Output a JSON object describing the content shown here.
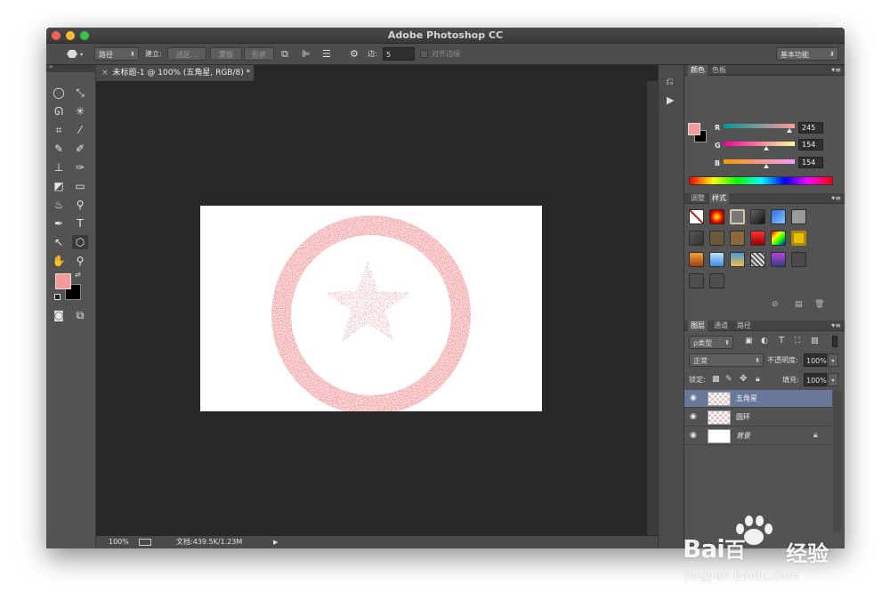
{
  "window": {
    "title": "Adobe Photoshop CC"
  },
  "options_bar": {
    "mode_dropdown": "路径",
    "make_label": "建立:",
    "selection_button": "选区...",
    "mask_button": "蒙版",
    "shape_button": "形状",
    "sides_label": "边:",
    "sides_value": "5",
    "align_edges_label": "对齐边缘",
    "workspace_dropdown": "基本功能"
  },
  "document": {
    "tab_title": "未标题-1 @ 100% (五角星, RGB/8) *",
    "zoom": "100%",
    "doc_size": "文档:439.5K/1.23M"
  },
  "colors": {
    "foreground": "#f59a9a",
    "background": "#000000",
    "accent_selection": "#68789a"
  },
  "color_panel": {
    "tabs": [
      "颜色",
      "色板"
    ],
    "r_label": "R",
    "r_value": "245",
    "g_label": "G",
    "g_value": "154",
    "b_label": "B",
    "b_value": "154"
  },
  "styles_panel": {
    "tabs": [
      "调整",
      "样式"
    ]
  },
  "layers_panel": {
    "tabs": [
      "图层",
      "通道",
      "路径"
    ],
    "filter_dropdown": "ρ类型",
    "blend_mode": "正常",
    "opacity_label": "不透明度:",
    "opacity_value": "100%",
    "lock_label": "锁定:",
    "fill_label": "填充:",
    "fill_value": "100%",
    "layers": [
      {
        "name": "五角星",
        "selected": true
      },
      {
        "name": "圆环",
        "selected": false
      },
      {
        "name": "背景",
        "selected": false,
        "locked": true
      }
    ]
  },
  "watermark": {
    "brand": "Bai",
    "brand_tail": "百",
    "site_label": "经验",
    "url": "jingyan.baidu.com"
  }
}
